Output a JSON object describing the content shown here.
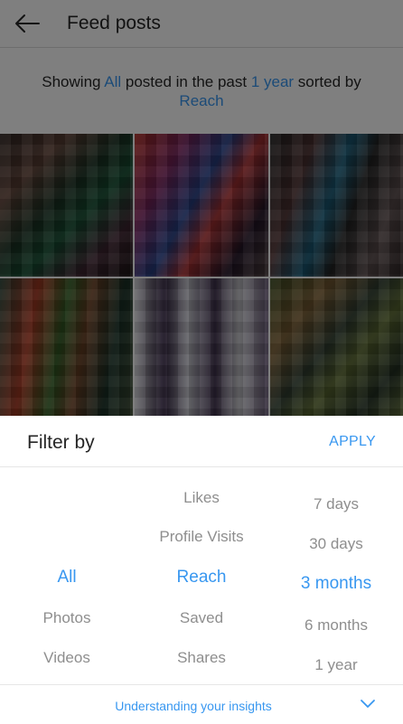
{
  "header": {
    "title": "Feed posts",
    "back_icon": "arrow-left-icon"
  },
  "summary": {
    "prefix": "Showing ",
    "type": "All",
    "middle": " posted in the past ",
    "period": "1 year",
    "suffix": " sorted by",
    "metric": "Reach"
  },
  "filter_sheet": {
    "title": "Filter by",
    "apply_label": "APPLY",
    "type_picker": {
      "items": [
        "All",
        "Photos",
        "Videos"
      ],
      "selected": "All"
    },
    "metric_picker": {
      "items": [
        "Likes",
        "Profile Visits",
        "Reach",
        "Saved",
        "Shares"
      ],
      "selected": "Reach"
    },
    "time_picker": {
      "items": [
        "7 days",
        "30 days",
        "3 months",
        "6 months",
        "1 year"
      ],
      "selected": "3 months"
    },
    "footer": {
      "link_label": "Understanding your insights",
      "chevron_icon": "chevron-down-icon"
    }
  },
  "colors": {
    "accent": "#3897f0",
    "muted_text": "#8e8e8e",
    "primary_text": "#262626"
  }
}
